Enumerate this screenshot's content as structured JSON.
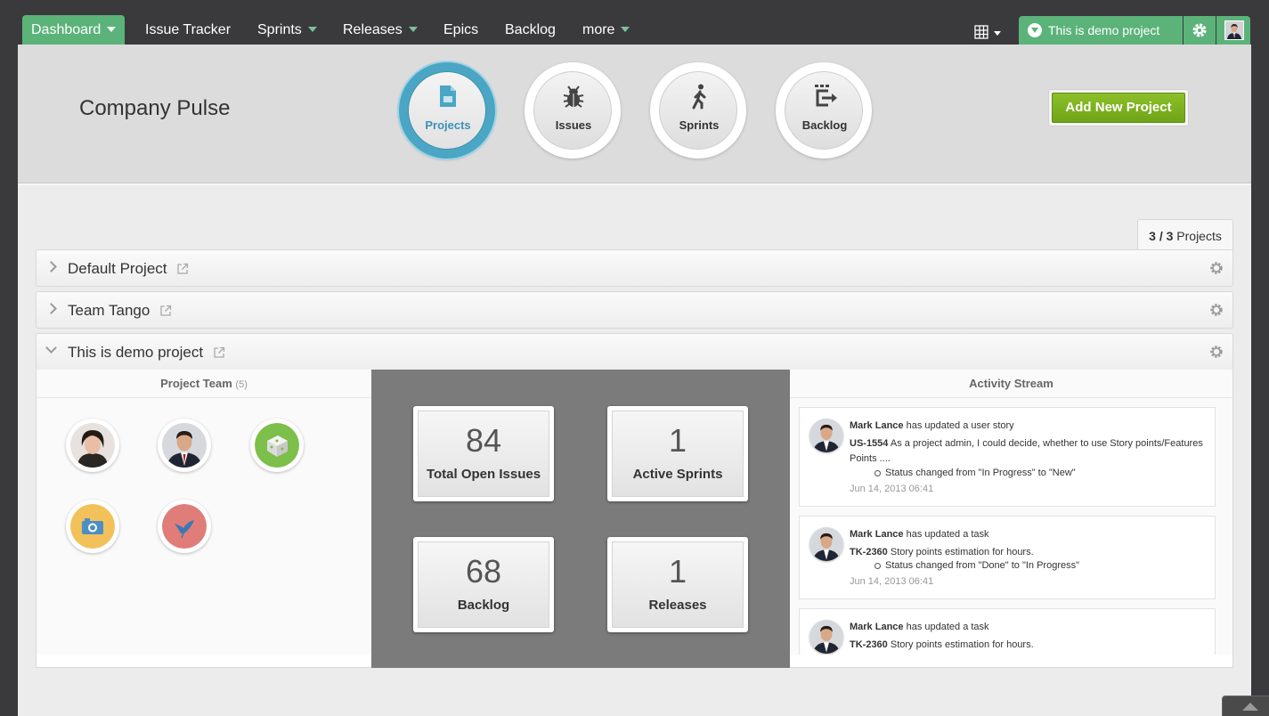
{
  "nav": {
    "items": [
      {
        "label": "Dashboard"
      },
      {
        "label": "Issue Tracker"
      },
      {
        "label": "Sprints"
      },
      {
        "label": "Releases"
      },
      {
        "label": "Epics"
      },
      {
        "label": "Backlog"
      },
      {
        "label": "more"
      }
    ],
    "current_project": "This is demo project",
    "icons": [
      "grid-icon",
      "gear-icon",
      "avatar"
    ]
  },
  "hero": {
    "title": "Company Pulse",
    "circles": [
      {
        "label": "Projects",
        "icon": "file-icon"
      },
      {
        "label": "Issues",
        "icon": "bug-icon"
      },
      {
        "label": "Sprints",
        "icon": "walker-icon"
      },
      {
        "label": "Backlog",
        "icon": "backlog-icon"
      }
    ],
    "add_button": "Add New Project"
  },
  "projects": {
    "count_shown": "3 / 3",
    "count_label": "Projects",
    "rows": [
      {
        "name": "Default Project"
      },
      {
        "name": "Team Tango"
      },
      {
        "name": "This is demo project"
      }
    ]
  },
  "demo": {
    "team_title": "Project Team",
    "team_count": "(5)",
    "stats": [
      {
        "value": "84",
        "label": "Total Open Issues"
      },
      {
        "value": "1",
        "label": "Active Sprints"
      },
      {
        "value": "68",
        "label": "Backlog"
      },
      {
        "value": "1",
        "label": "Releases"
      }
    ],
    "activity_title": "Activity Stream",
    "activity": [
      {
        "user": "Mark Lance",
        "action": "has updated a user story",
        "key": "US-1554",
        "summary": "As a project admin, I could decide, whether to use Story points/Features Points ....",
        "change": "Status changed from \"In Progress\" to \"New\"",
        "time": "Jun 14, 2013 06:41"
      },
      {
        "user": "Mark Lance",
        "action": "has updated a task",
        "key": "TK-2360",
        "summary": "Story points estimation for hours.",
        "change": "Status changed from \"Done\" to \"In Progress\"",
        "time": "Jun 14, 2013 06:41"
      },
      {
        "user": "Mark Lance",
        "action": "has updated a task",
        "key": "TK-2360",
        "summary": "Story points estimation for hours."
      }
    ]
  },
  "colors": {
    "accent_green": "#5bb37a",
    "active_blue": "#4aa6c4",
    "button_green": "#7fb421",
    "stats_bg": "#7b7b7b"
  }
}
